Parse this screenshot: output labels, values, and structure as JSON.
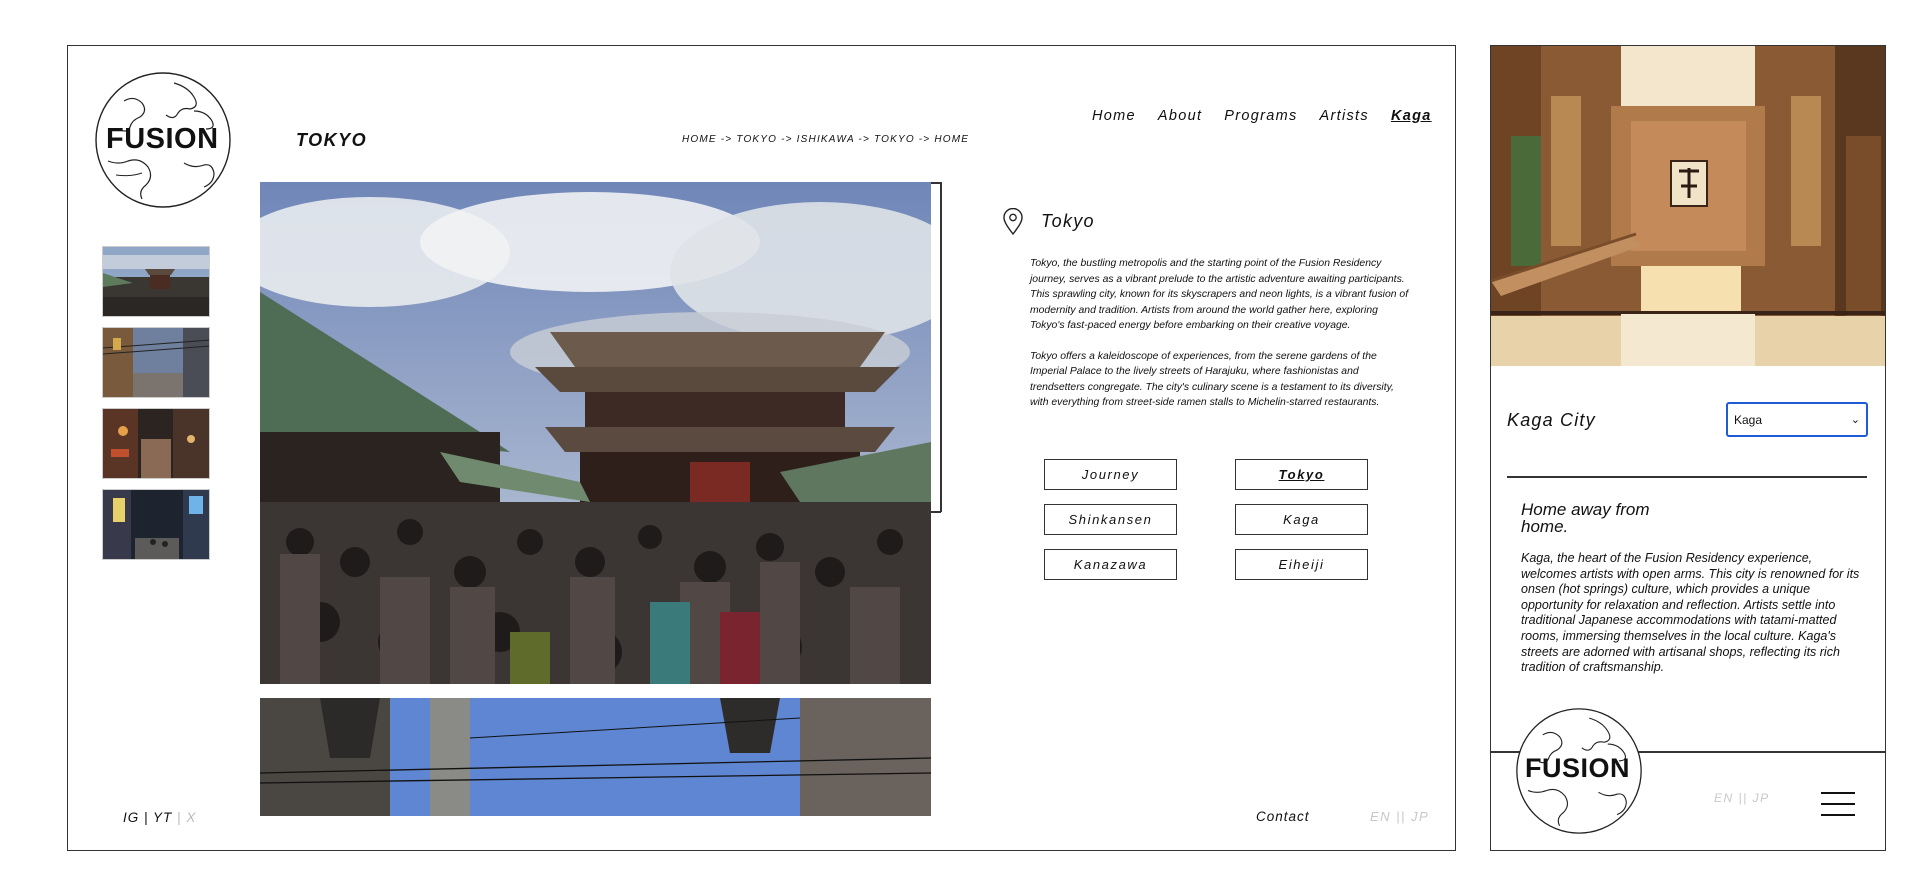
{
  "desktop": {
    "logo": {
      "text": "FUSION"
    },
    "page_title": "TOKYO",
    "breadcrumb": "HOME -> TOKYO -> ISHIKAWA -> TOKYO -> HOME",
    "nav": [
      {
        "label": "Home"
      },
      {
        "label": "About"
      },
      {
        "label": "Programs"
      },
      {
        "label": "Artists"
      },
      {
        "label": "Kaga",
        "active": true
      }
    ],
    "thumbnails": [
      "temple-thumbnail",
      "street-thumbnail",
      "night-alley-thumbnail",
      "night-street-thumbnail"
    ],
    "section": {
      "icon": "location-pin-icon",
      "title": "Tokyo",
      "paragraphs": [
        "Tokyo, the bustling metropolis and the starting point of the Fusion Residency journey, serves as a vibrant prelude to the artistic adventure awaiting participants. This sprawling city, known for its skyscrapers and neon lights, is a vibrant fusion of modernity and tradition. Artists from around the world gather here, exploring Tokyo's fast-paced energy before embarking on their creative voyage.",
        "Tokyo offers a kaleidoscope of experiences, from the serene gardens of the Imperial Palace to the lively streets of Harajuku, where fashionistas and trendsetters congregate. The city's culinary scene is a testament to its diversity, with everything from street-side ramen stalls to Michelin-starred restaurants."
      ]
    },
    "buttons": {
      "journey": "Journey",
      "tokyo": "Tokyo",
      "shinkansen": "Shinkansen",
      "kaga": "Kaga",
      "kanazawa": "Kanazawa",
      "eiheiji": "Eiheiji"
    },
    "footer": {
      "social_ig": "IG",
      "sep1": " | ",
      "social_yt": "YT",
      "sep2": " | ",
      "social_x": "X",
      "contact": "Contact",
      "language": "EN || JP"
    }
  },
  "mobile": {
    "city_title": "Kaga City",
    "select_value": "Kaga",
    "heading": "Home away from home.",
    "description": "Kaga, the heart of the Fusion Residency experience, welcomes artists with open arms. This city is renowned for its onsen (hot springs) culture, which provides a unique opportunity for relaxation and reflection. Artists settle into traditional Japanese accommodations with tatami-matted rooms, immersing themselves in the local culture. Kaga's streets are adorned with artisanal shops, reflecting its rich tradition of craftsmanship.",
    "logo_text": "FUSION",
    "language": "EN || JP",
    "menu_icon": "hamburger-menu-icon"
  },
  "colors": {
    "border": "#333333",
    "select_border": "#1f5bd6",
    "muted_text": "#c8c8c8"
  }
}
